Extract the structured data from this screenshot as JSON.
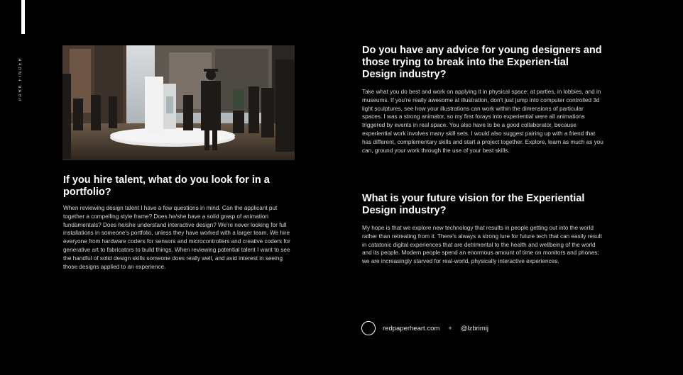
{
  "sidebar": {
    "vertical_label": "PARK FINDER"
  },
  "left": {
    "heading": "If you hire talent, what do you look for in a portfolio?",
    "body": "When reviewing design talent I have a few questions in mind. Can the applicant put together a compelling style frame? Does he/she have a solid grasp of animation fundamentals? Does he/she understand interactive design? We're never looking for full installations in someone's portfolio, unless they have worked with a larger team. We hire everyone from hardware coders for sensors and microcontrollers and creative coders for generative art to fabricators to build things. When reviewing potential talent I want to see the handful of solid design skills someone does really well, and avid interest in seeing those designs applied to an experience."
  },
  "right": {
    "q1_heading": "Do you have any advice for young designers and those trying to break into the Experien-tial Design industry?",
    "q1_body": "Take what you do best and work on applying it in physical space: at parties, in lobbies, and in museums. If you're really awesome at illustration, don't just jump into computer controlled 3d light sculptures, see how your illustrations can work within the dimensions of particular spaces. I was a strong animator, so my first forays into experiential were all animations triggered by events in real space. You also have to be a good collaborator, because experiential work involves many skill sets. I would also suggest pairing up with a friend that has different, complementary skills and start a project together. Explore, learn as much as you can, ground your work through the use of your best skills.",
    "q2_heading": "What is your future vision for the Experiential Design industry?",
    "q2_body": "My hope is that we explore new technology that results in people getting out into the world rather than retreating from it. There's always a strong lure for future tech that can easily result in catatonic digital experiences that are detrimental to the health and wellbeing of the world and its people. Modern people spend an enormous amount of time on monitors and phones; we are increasingly starved for real-world, physically interactive experiences."
  },
  "footer": {
    "website": "redpaperheart.com",
    "separator": "+",
    "handle": "@lzbrimij"
  }
}
